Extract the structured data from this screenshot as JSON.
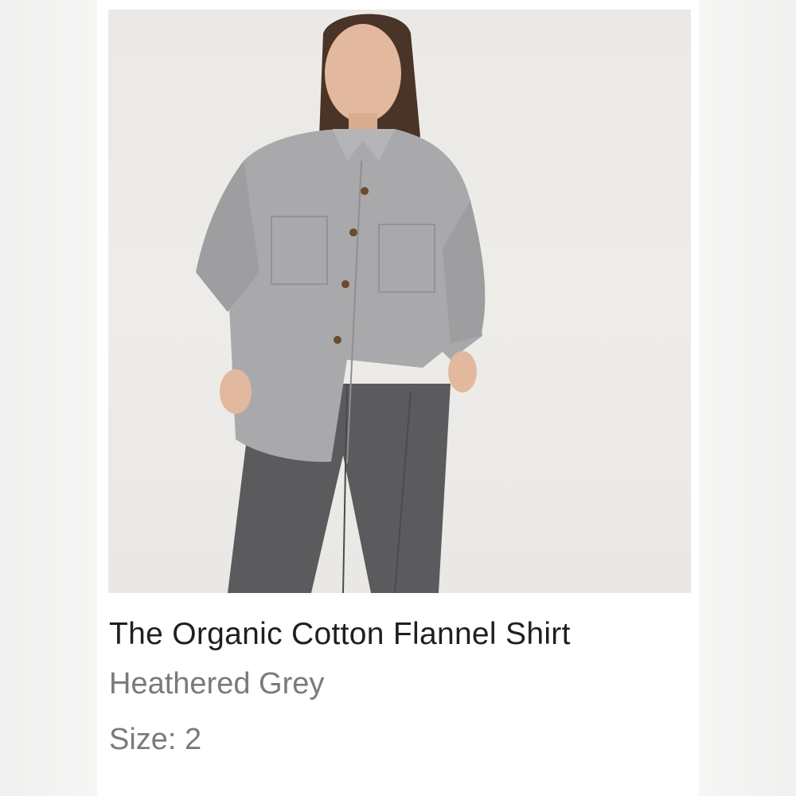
{
  "product": {
    "name": "The Organic Cotton Flannel Shirt",
    "color": "Heathered Grey",
    "size_label": "Size: 2"
  },
  "image": {
    "subject": "model-wearing-shirt"
  },
  "colors": {
    "shirt": "#a9a9ab",
    "pants": "#5b5b5e",
    "background": "#ebe9e6",
    "title_text": "#1f1f1f",
    "meta_text": "#7a7a7a"
  }
}
